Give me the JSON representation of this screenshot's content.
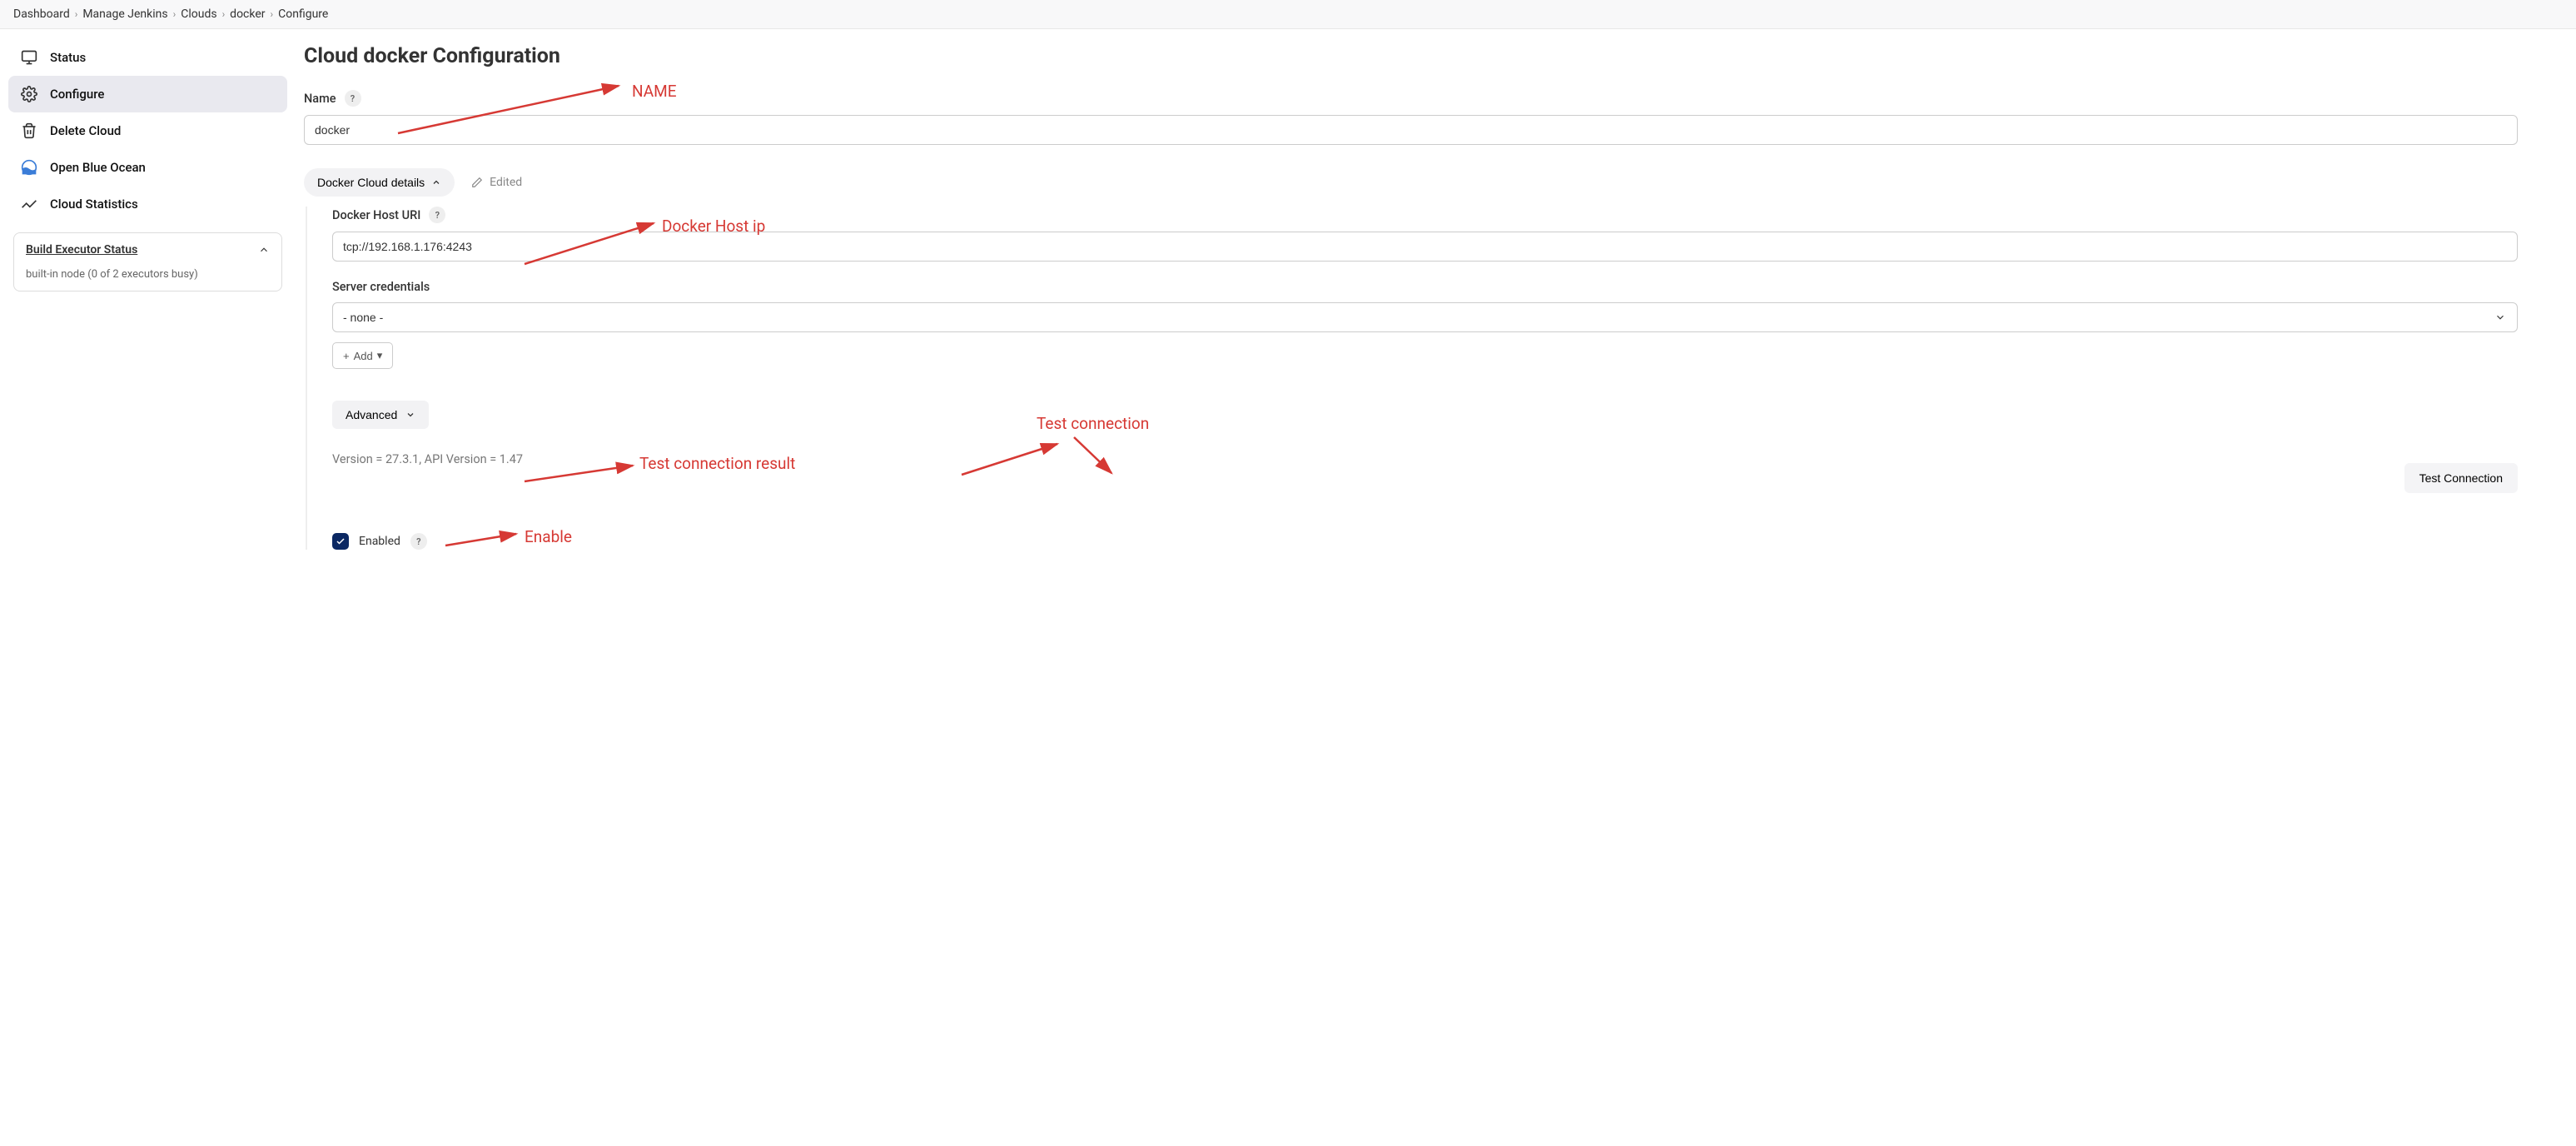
{
  "breadcrumb": [
    {
      "label": "Dashboard"
    },
    {
      "label": "Manage Jenkins"
    },
    {
      "label": "Clouds"
    },
    {
      "label": "docker"
    },
    {
      "label": "Configure"
    }
  ],
  "sidebar": {
    "items": [
      {
        "label": "Status",
        "icon": "monitor"
      },
      {
        "label": "Configure",
        "icon": "gear",
        "active": true
      },
      {
        "label": "Delete Cloud",
        "icon": "trash"
      },
      {
        "label": "Open Blue Ocean",
        "icon": "blueocean"
      },
      {
        "label": "Cloud Statistics",
        "icon": "stats"
      }
    ],
    "panel": {
      "title": "Build Executor Status",
      "subtitle": "built-in node (0 of 2 executors busy)"
    }
  },
  "page": {
    "title": "Cloud docker Configuration",
    "name_label": "Name",
    "name_value": "docker",
    "details_button": "Docker Cloud details",
    "edited_label": "Edited",
    "host_uri_label": "Docker Host URI",
    "host_uri_value": "tcp://192.168.1.176:4243",
    "server_credentials_label": "Server credentials",
    "server_credentials_value": "- none -",
    "add_button": "Add",
    "advanced_button": "Advanced",
    "version_text": "Version = 27.3.1, API Version = 1.47",
    "test_button": "Test Connection",
    "enabled_label": "Enabled"
  },
  "annotations": {
    "name": "NAME",
    "host_ip": "Docker Host ip",
    "test_result": "Test connection result",
    "test_conn": "Test connection",
    "enable": "Enable"
  }
}
